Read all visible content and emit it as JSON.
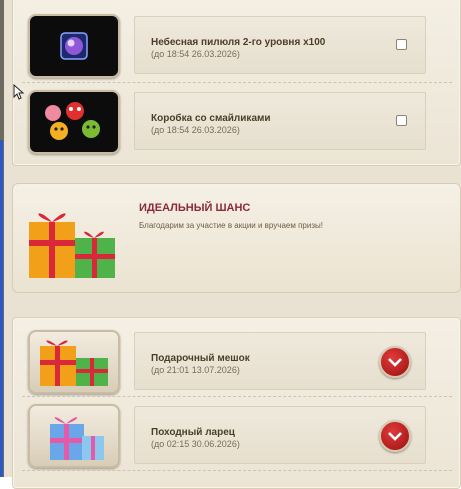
{
  "items": [
    {
      "title": "Небесная пилюля 2-го уровня х100",
      "until": "(до 18:54 26.03.2026)",
      "icon": "purple-orb-icon"
    },
    {
      "title": "Коробка со смайликами",
      "until": "(до 18:54 26.03.2026)",
      "icon": "smiley-box-icon"
    }
  ],
  "banner": {
    "title": "ИДЕАЛЬНЫЙ ШАНС",
    "subtitle": "Благодарим за участие в акции и вручаем призы!",
    "icon": "gift-boxes-icon"
  },
  "prizes": [
    {
      "title": "Подарочный мешок",
      "until": "(до 21:01 13.07.2026)",
      "icon": "gift-boxes-icon"
    },
    {
      "title": "Походный ларец",
      "until": "(до 02:15 30.06.2026)",
      "icon": "blue-gift-box-icon"
    }
  ],
  "colors": {
    "accent": "#8a2a3a",
    "expand_button": "#c21a1a",
    "panel_bg": "#efe9dc"
  }
}
